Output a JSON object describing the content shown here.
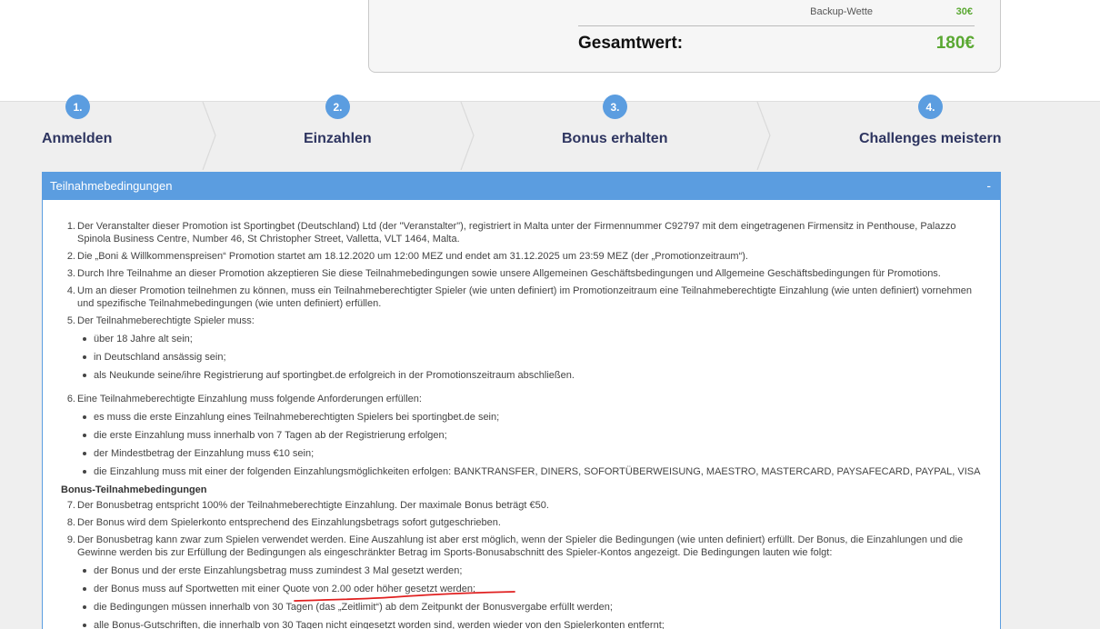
{
  "summary": {
    "backup_label": "Backup-Wette",
    "backup_value": "30€",
    "total_label": "Gesamtwert:",
    "total_value": "180€"
  },
  "steps": [
    {
      "num": "1.",
      "label": "Anmelden"
    },
    {
      "num": "2.",
      "label": "Einzahlen"
    },
    {
      "num": "3.",
      "label": "Bonus erhalten"
    },
    {
      "num": "4.",
      "label": "Challenges meistern"
    }
  ],
  "panel": {
    "title": "Teilnahmebedingungen",
    "toggle": "-",
    "conditions_a": [
      {
        "n": "1.",
        "text": "Der Veranstalter dieser Promotion ist Sportingbet (Deutschland) Ltd (der \"Veranstalter\"), registriert in Malta unter der Firmennummer C92797 mit dem eingetragenen Firmensitz in Penthouse, Palazzo Spinola Business Centre, Number 46, St Christopher Street, Valletta, VLT 1464, Malta."
      },
      {
        "n": "2.",
        "text": "Die „Boni & Willkommenspreisen“ Promotion startet am 18.12.2020 um 12:00 MEZ und endet am 31.12.2025 um 23:59 MEZ (der „Promotionzeitraum“)."
      },
      {
        "n": "3.",
        "text": "Durch Ihre Teilnahme an dieser Promotion akzeptieren Sie diese Teilnahmebedingungen sowie unsere Allgemeinen Geschäftsbedingungen und Allgemeine Geschäftsbedingungen für Promotions."
      },
      {
        "n": "4.",
        "text": "Um an dieser Promotion teilnehmen zu können, muss ein Teilnahmeberechtigter Spieler (wie unten definiert) im Promotionzeitraum eine Teilnahmeberechtigte Einzahlung (wie unten definiert) vornehmen und spezifische Teilnahmebedingungen (wie unten definiert) erfüllen."
      },
      {
        "n": "5.",
        "text": "Der Teilnahmeberechtigte Spieler muss:"
      }
    ],
    "player_reqs": [
      "über 18 Jahre alt sein;",
      "in Deutschland ansässig sein;",
      "als Neukunde seine/ihre Registrierung auf sportingbet.de erfolgreich in der Promotionszeitraum abschließen."
    ],
    "cond6": {
      "n": "6.",
      "text": "Eine Teilnahmeberechtigte Einzahlung muss folgende Anforderungen erfüllen:"
    },
    "deposit_reqs": [
      "es muss die erste Einzahlung eines Teilnahmeberechtigten Spielers bei sportingbet.de sein;",
      "die erste Einzahlung muss innerhalb von 7 Tagen ab der Registrierung erfolgen;",
      "der Mindestbetrag der Einzahlung muss €10 sein;",
      "die Einzahlung muss mit einer der folgenden Einzahlungsmöglichkeiten erfolgen: BANKTRANSFER, DINERS, SOFORTÜBERWEISUNG, MAESTRO, MASTERCARD, PAYSAFECARD, PAYPAL, VISA"
    ],
    "bonus_title": "Bonus-Teilnahmebedingungen",
    "conditions_b": [
      {
        "n": "7.",
        "text": "Der Bonusbetrag entspricht 100% der Teilnahmeberechtigte Einzahlung. Der maximale Bonus beträgt €50."
      },
      {
        "n": "8.",
        "text": "Der Bonus wird dem Spielerkonto entsprechend des Einzahlungsbetrags sofort gutgeschrieben."
      },
      {
        "n": "9.",
        "text": "Der Bonusbetrag kann zwar zum Spielen verwendet werden. Eine Auszahlung ist aber erst möglich, wenn der Spieler die Bedingungen (wie unten definiert) erfüllt. Der Bonus, die Einzahlungen und die Gewinne werden bis zur Erfüllung der Bedingungen als eingeschränkter Betrag im Sports-Bonusabschnitt des Spieler-Kontos angezeigt. Die Bedingungen lauten wie folgt:"
      }
    ],
    "bonus_reqs": [
      "der Bonus und der erste Einzahlungsbetrag muss zumindest 3 Mal gesetzt werden;",
      "der Bonus muss auf Sportwetten mit einer Quote von 2.00 oder höher gesetzt werden;",
      "die Bedingungen müssen innerhalb von 30 Tagen (das „Zeitlimit“) ab dem Zeitpunkt der Bonusvergabe erfüllt werden;",
      "alle Bonus-Gutschriften, die innerhalb von 30 Tagen nicht eingesetzt worden sind, werden wieder von den Spielerkonten entfernt;"
    ],
    "annotation_color": "#e02020"
  }
}
